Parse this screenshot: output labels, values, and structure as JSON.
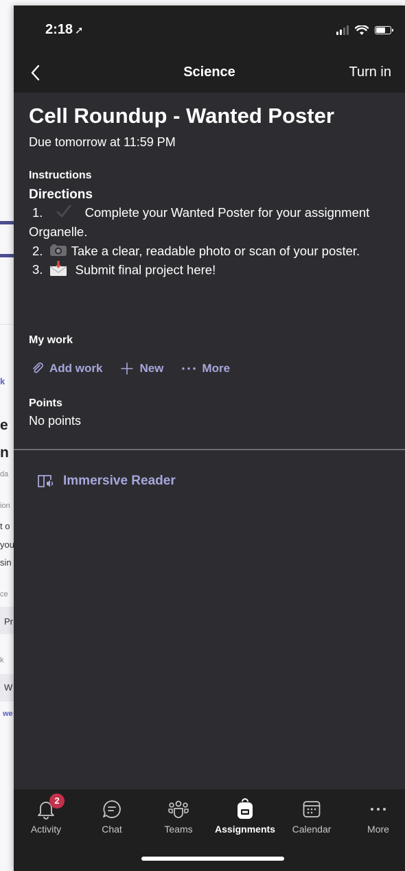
{
  "background_window": {
    "fragments": [
      "k",
      "e",
      "n",
      "da",
      "ion",
      "t o",
      "you",
      "sin",
      "ce",
      "Pr",
      "k",
      "W",
      "we"
    ]
  },
  "status_bar": {
    "time": "2:18"
  },
  "nav": {
    "title": "Science",
    "turn_in": "Turn in"
  },
  "assignment": {
    "title": "Cell Roundup - Wanted Poster",
    "due": "Due tomorrow at 11:59 PM",
    "instructions_label": "Instructions",
    "directions_heading": "Directions",
    "steps": [
      {
        "number": "1.",
        "emoji": "check-mark-icon",
        "text": "Complete your Wanted Poster for your assignment Organelle."
      },
      {
        "number": "2.",
        "emoji": "camera-icon",
        "text": "Take a clear, readable photo or scan of your poster."
      },
      {
        "number": "3.",
        "emoji": "envelope-icon",
        "text": "Submit final project here!"
      }
    ]
  },
  "my_work": {
    "label": "My work",
    "actions": [
      {
        "label": "Add work",
        "icon": "paperclip-icon"
      },
      {
        "label": "New",
        "icon": "plus-icon"
      },
      {
        "label": "More",
        "icon": "ellipsis-icon"
      }
    ]
  },
  "points": {
    "label": "Points",
    "value": "No points"
  },
  "immersive_reader": {
    "label": "Immersive Reader",
    "icon": "immersive-reader-icon"
  },
  "tabs": [
    {
      "label": "Activity",
      "icon": "bell-icon",
      "badge": "2"
    },
    {
      "label": "Chat",
      "icon": "chat-icon"
    },
    {
      "label": "Teams",
      "icon": "teams-icon"
    },
    {
      "label": "Assignments",
      "icon": "backpack-icon",
      "active": true
    },
    {
      "label": "Calendar",
      "icon": "calendar-icon"
    },
    {
      "label": "More",
      "icon": "more-icon"
    }
  ],
  "colors": {
    "background": "#2d2c30",
    "bars": "#1f1f1f",
    "accent": "#a6a7dc",
    "badge": "#c4314b",
    "text": "#ffffff"
  }
}
